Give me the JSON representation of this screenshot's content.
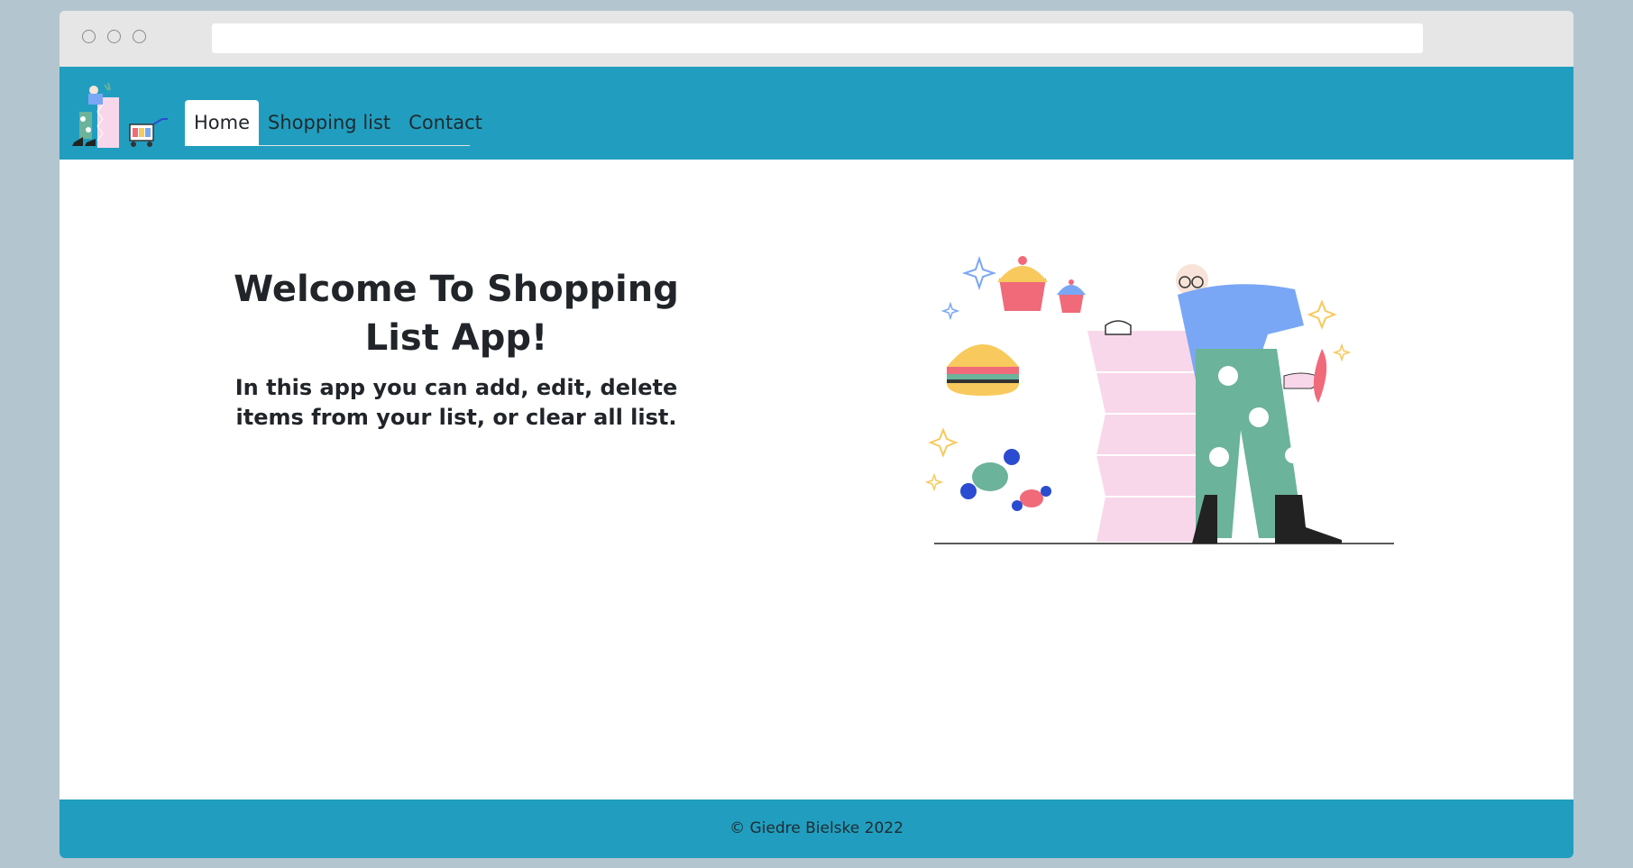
{
  "browser": {
    "address_bar_value": ""
  },
  "navbar": {
    "logo_icon": "shopping-cart-person-illustration",
    "items": [
      {
        "label": "Home",
        "active": true
      },
      {
        "label": "Shopping list",
        "active": false
      },
      {
        "label": "Contact",
        "active": false
      }
    ]
  },
  "hero": {
    "title": "Welcome To Shopping List App!",
    "subtitle": "In this app you can add, edit, delete items from your list, or clear all list.",
    "illustration_icon": "person-with-shopping-list-illustration"
  },
  "footer": {
    "text": "© Giedre Bielske 2022"
  },
  "colors": {
    "brand": "#219ebf",
    "background": "#b3c5cf"
  }
}
